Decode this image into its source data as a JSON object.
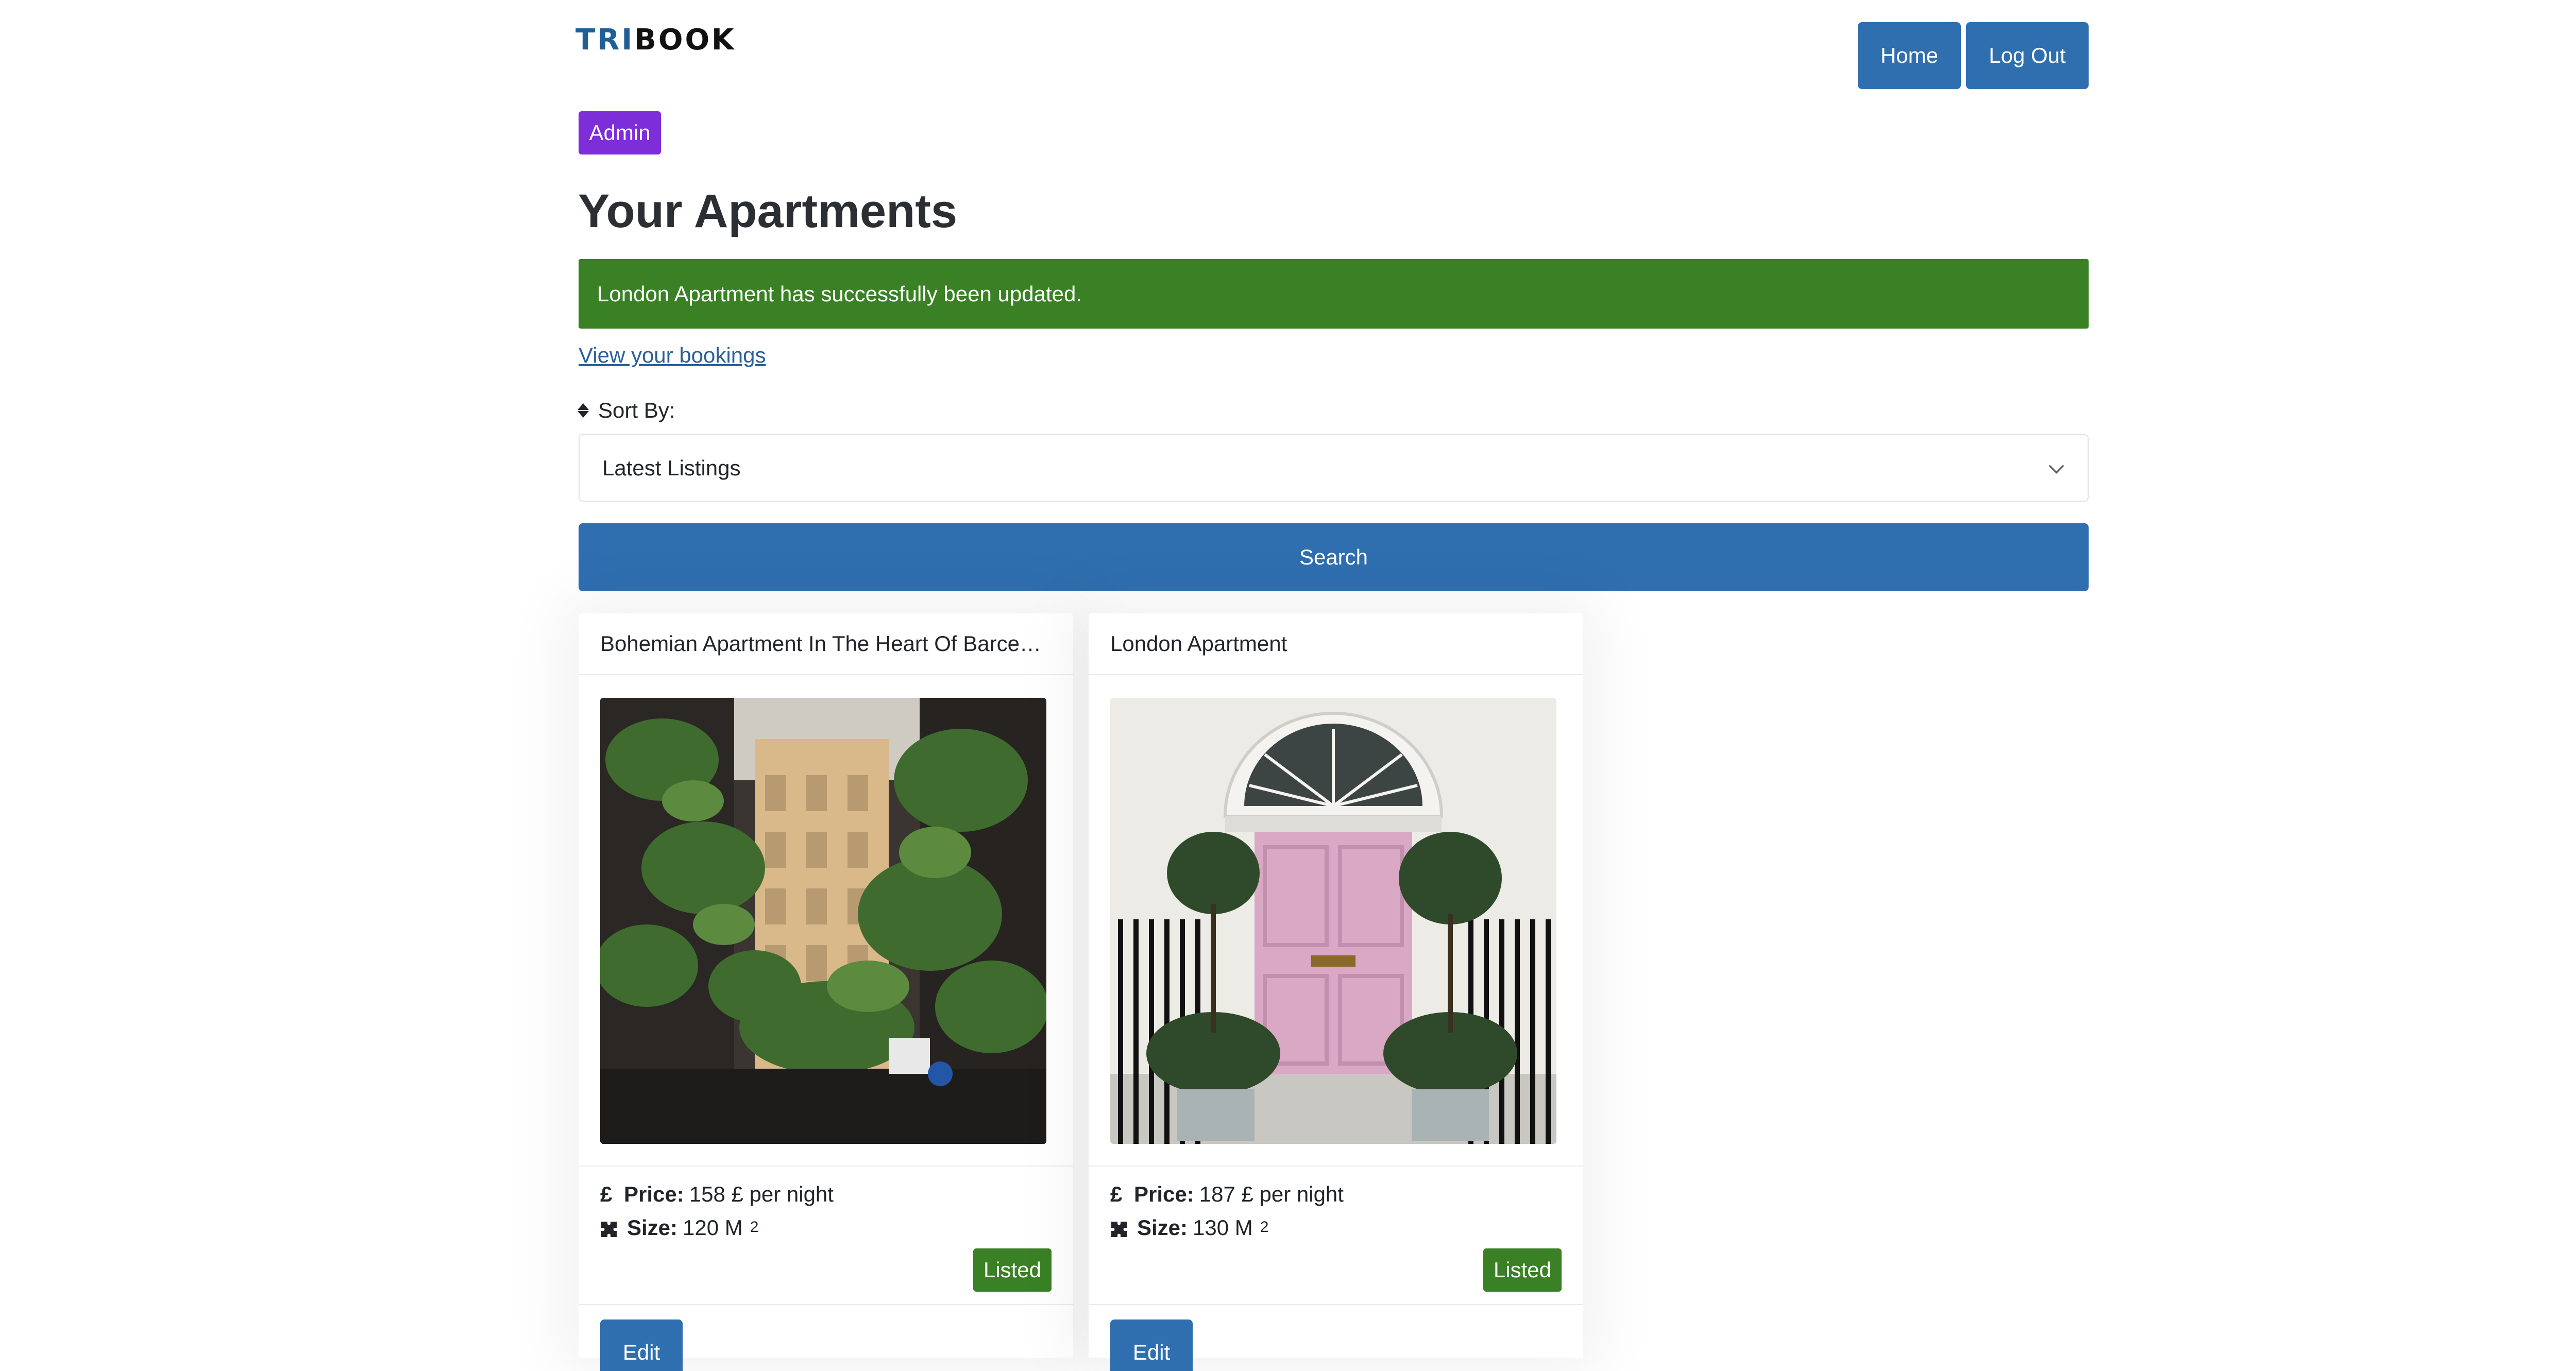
{
  "brand": {
    "logo_part1": "TRI",
    "logo_part2": "BOOK",
    "primary_color": "#2f6fb0",
    "success_color": "#3a8024",
    "admin_color": "#7e2ed8"
  },
  "nav": {
    "home_label": "Home",
    "logout_label": "Log Out"
  },
  "user": {
    "role_badge": "Admin"
  },
  "page": {
    "title": "Your Apartments"
  },
  "alert": {
    "message": "London Apartment has successfully been updated."
  },
  "links": {
    "bookings": "View your bookings"
  },
  "sort": {
    "label": "Sort By:",
    "selected": "Latest Listings",
    "icon": "sort-icon"
  },
  "search": {
    "button_label": "Search"
  },
  "apartments": [
    {
      "title": "Bohemian Apartment In The Heart Of Barcelo...",
      "image": "barcelona-street-photo",
      "price_label": "Price:",
      "price_value": "158 £ per night",
      "size_label": "Size:",
      "size_value": "120 M",
      "size_unit_sup": "2",
      "status": "Listed",
      "edit_label": "Edit"
    },
    {
      "title": "London Apartment",
      "image": "london-pink-door-photo",
      "price_label": "Price:",
      "price_value": "187 £ per night",
      "size_label": "Size:",
      "size_value": "130 M",
      "size_unit_sup": "2",
      "status": "Listed",
      "edit_label": "Edit"
    }
  ],
  "icons": {
    "currency": "£",
    "size": "puzzle-icon"
  }
}
